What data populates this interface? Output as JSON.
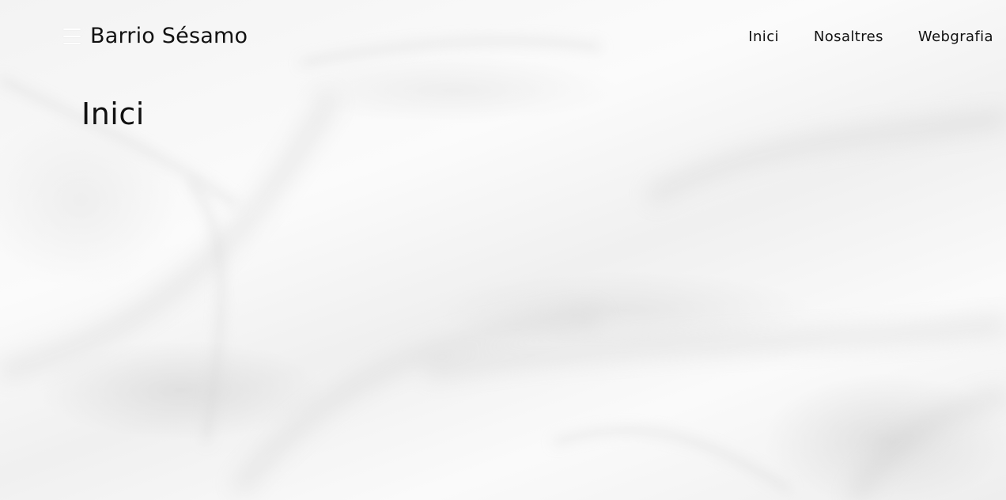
{
  "header": {
    "site_title": "Barrio Sésamo",
    "menu_icon": "hamburger-menu-icon",
    "nav": [
      {
        "label": "Inici"
      },
      {
        "label": "Nosaltres"
      },
      {
        "label": "Webgrafia"
      }
    ]
  },
  "main": {
    "page_title": "Inici"
  },
  "background": {
    "description_color": "#f7f7f7"
  }
}
